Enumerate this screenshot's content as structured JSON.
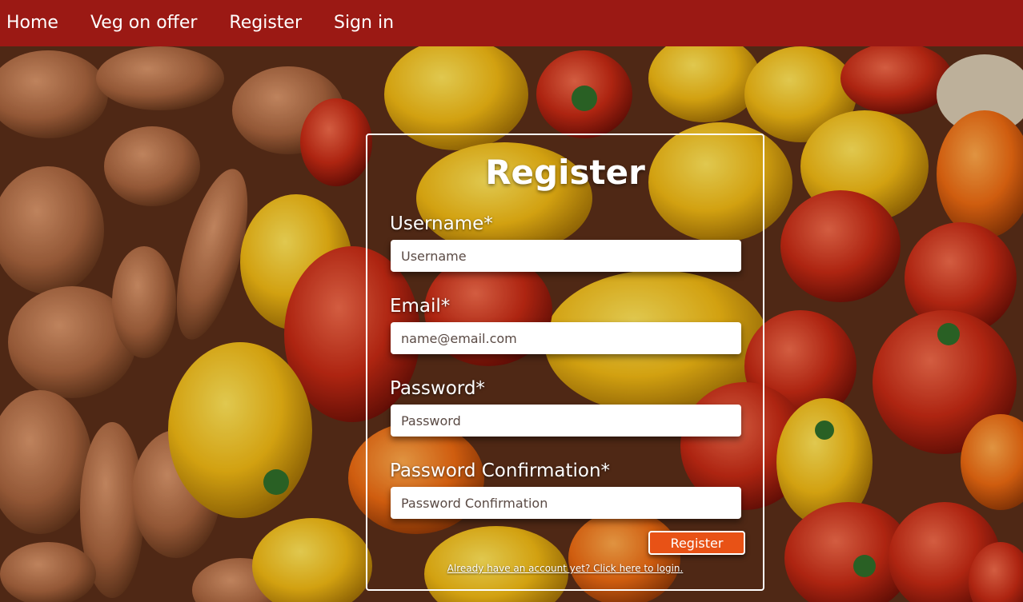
{
  "nav": {
    "items": [
      {
        "label": "Home"
      },
      {
        "label": "Veg on offer"
      },
      {
        "label": "Register"
      },
      {
        "label": "Sign in"
      }
    ]
  },
  "form": {
    "title": "Register",
    "fields": [
      {
        "label": "Username*",
        "placeholder": "Username"
      },
      {
        "label": "Email*",
        "placeholder": "name@email.com"
      },
      {
        "label": "Password*",
        "placeholder": "Password"
      },
      {
        "label": "Password Confirmation*",
        "placeholder": "Password Confirmation"
      }
    ],
    "submit_label": "Register",
    "login_link": "Already have an account yet? Click here to login."
  },
  "colors": {
    "navbar": "#9b1914",
    "button": "#e85216",
    "text": "#ffffff"
  },
  "background": {
    "description_icon": "vegetables-photo"
  }
}
